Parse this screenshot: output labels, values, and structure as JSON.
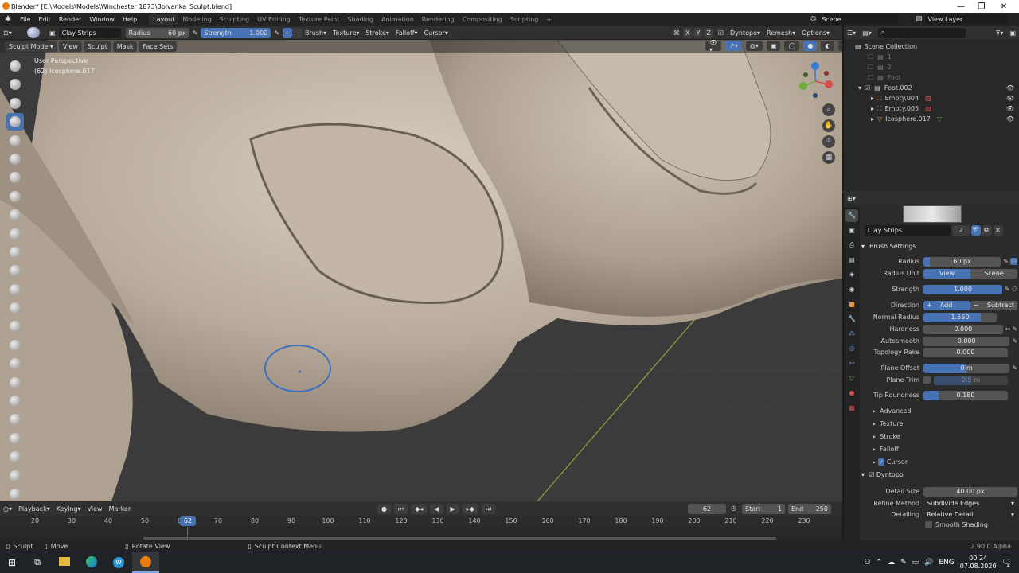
{
  "window": {
    "title": "Blender* [E:\\Models\\Models\\Winchester 1873\\Bolvanka_Sculpt.blend]"
  },
  "menu": [
    "File",
    "Edit",
    "Render",
    "Window",
    "Help"
  ],
  "workspaces": [
    "Layout",
    "Modeling",
    "Sculpting",
    "UV Editing",
    "Texture Paint",
    "Shading",
    "Animation",
    "Rendering",
    "Compositing",
    "Scripting"
  ],
  "top_right": {
    "scene": "Scene",
    "view_layer": "View Layer"
  },
  "tool_header": {
    "brush_name": "Clay Strips",
    "radius_label": "Radius",
    "radius_value": "60 px",
    "strength_label": "Strength",
    "strength_value": "1.000",
    "brush": "Brush",
    "texture": "Texture",
    "stroke": "Stroke",
    "falloff": "Falloff",
    "cursor": "Cursor",
    "axes": [
      "X",
      "Y",
      "Z"
    ],
    "dyntopo": "Dyntopo",
    "remesh": "Remesh",
    "options": "Options"
  },
  "mode_header": {
    "mode": "Sculpt Mode",
    "view": "View",
    "sculpt": "Sculpt",
    "mask": "Mask",
    "face_sets": "Face Sets"
  },
  "viewport": {
    "perspective": "User Perspective",
    "object": "(62) Icosphere.017"
  },
  "outliner": {
    "root": "Scene Collection",
    "items": [
      {
        "name": "1"
      },
      {
        "name": "2"
      },
      {
        "name": "Foot"
      },
      {
        "name": "Foot.002"
      },
      {
        "name": "Empty.004"
      },
      {
        "name": "Empty.005"
      },
      {
        "name": "Icosphere.017"
      }
    ]
  },
  "properties": {
    "brush_name": "Clay Strips",
    "brush_users": "2",
    "brush_settings_title": "Brush Settings",
    "radius_label": "Radius",
    "radius_value": "60 px",
    "radius_unit_label": "Radius Unit",
    "radius_unit_view": "View",
    "radius_unit_scene": "Scene",
    "strength_label": "Strength",
    "strength_value": "1.000",
    "direction_label": "Direction",
    "direction_add": "Add",
    "direction_subtract": "Subtract",
    "normal_radius_label": "Normal Radius",
    "normal_radius_value": "1.550",
    "hardness_label": "Hardness",
    "hardness_value": "0.000",
    "autosmooth_label": "Autosmooth",
    "autosmooth_value": "0.000",
    "topology_rake_label": "Topology Rake",
    "topology_rake_value": "0.000",
    "plane_offset_label": "Plane Offset",
    "plane_offset_value": "0 m",
    "plane_trim_label": "Plane Trim",
    "plane_trim_value": "0.5 m",
    "tip_roundness_label": "Tip Roundness",
    "tip_roundness_value": "0.180",
    "subpanels": [
      "Advanced",
      "Texture",
      "Stroke",
      "Falloff",
      "Cursor"
    ],
    "dyntopo_title": "Dyntopo",
    "detail_size_label": "Detail Size",
    "detail_size_value": "40.00 px",
    "refine_method_label": "Refine Method",
    "refine_method_value": "Subdivide Edges",
    "detailing_label": "Detailing",
    "detailing_value": "Relative Detail",
    "smooth_shading": "Smooth Shading"
  },
  "timeline": {
    "playback": "Playback",
    "keying": "Keying",
    "view": "View",
    "marker": "Marker",
    "current_frame": "62",
    "start_label": "Start",
    "start": "1",
    "end_label": "End",
    "end": "250",
    "ticks": [
      "20",
      "30",
      "40",
      "50",
      "60",
      "70",
      "80",
      "90",
      "100",
      "110",
      "120",
      "130",
      "140",
      "150",
      "160",
      "170",
      "180",
      "190",
      "200",
      "210",
      "220",
      "230"
    ]
  },
  "status": {
    "sculpt": "Sculpt",
    "move": "Move",
    "rotate_view": "Rotate View",
    "context_menu": "Sculpt Context Menu",
    "version": "2.90.0 Alpha"
  },
  "taskbar": {
    "lang": "ENG",
    "time": "00:24",
    "date": "07.08.2020",
    "notif": "2"
  },
  "colors": {
    "accent": "#4772b3",
    "active_tool": "#4772b3",
    "header": "#303030",
    "panel": "#2b2b2b",
    "skin": "#bfb2a3"
  }
}
